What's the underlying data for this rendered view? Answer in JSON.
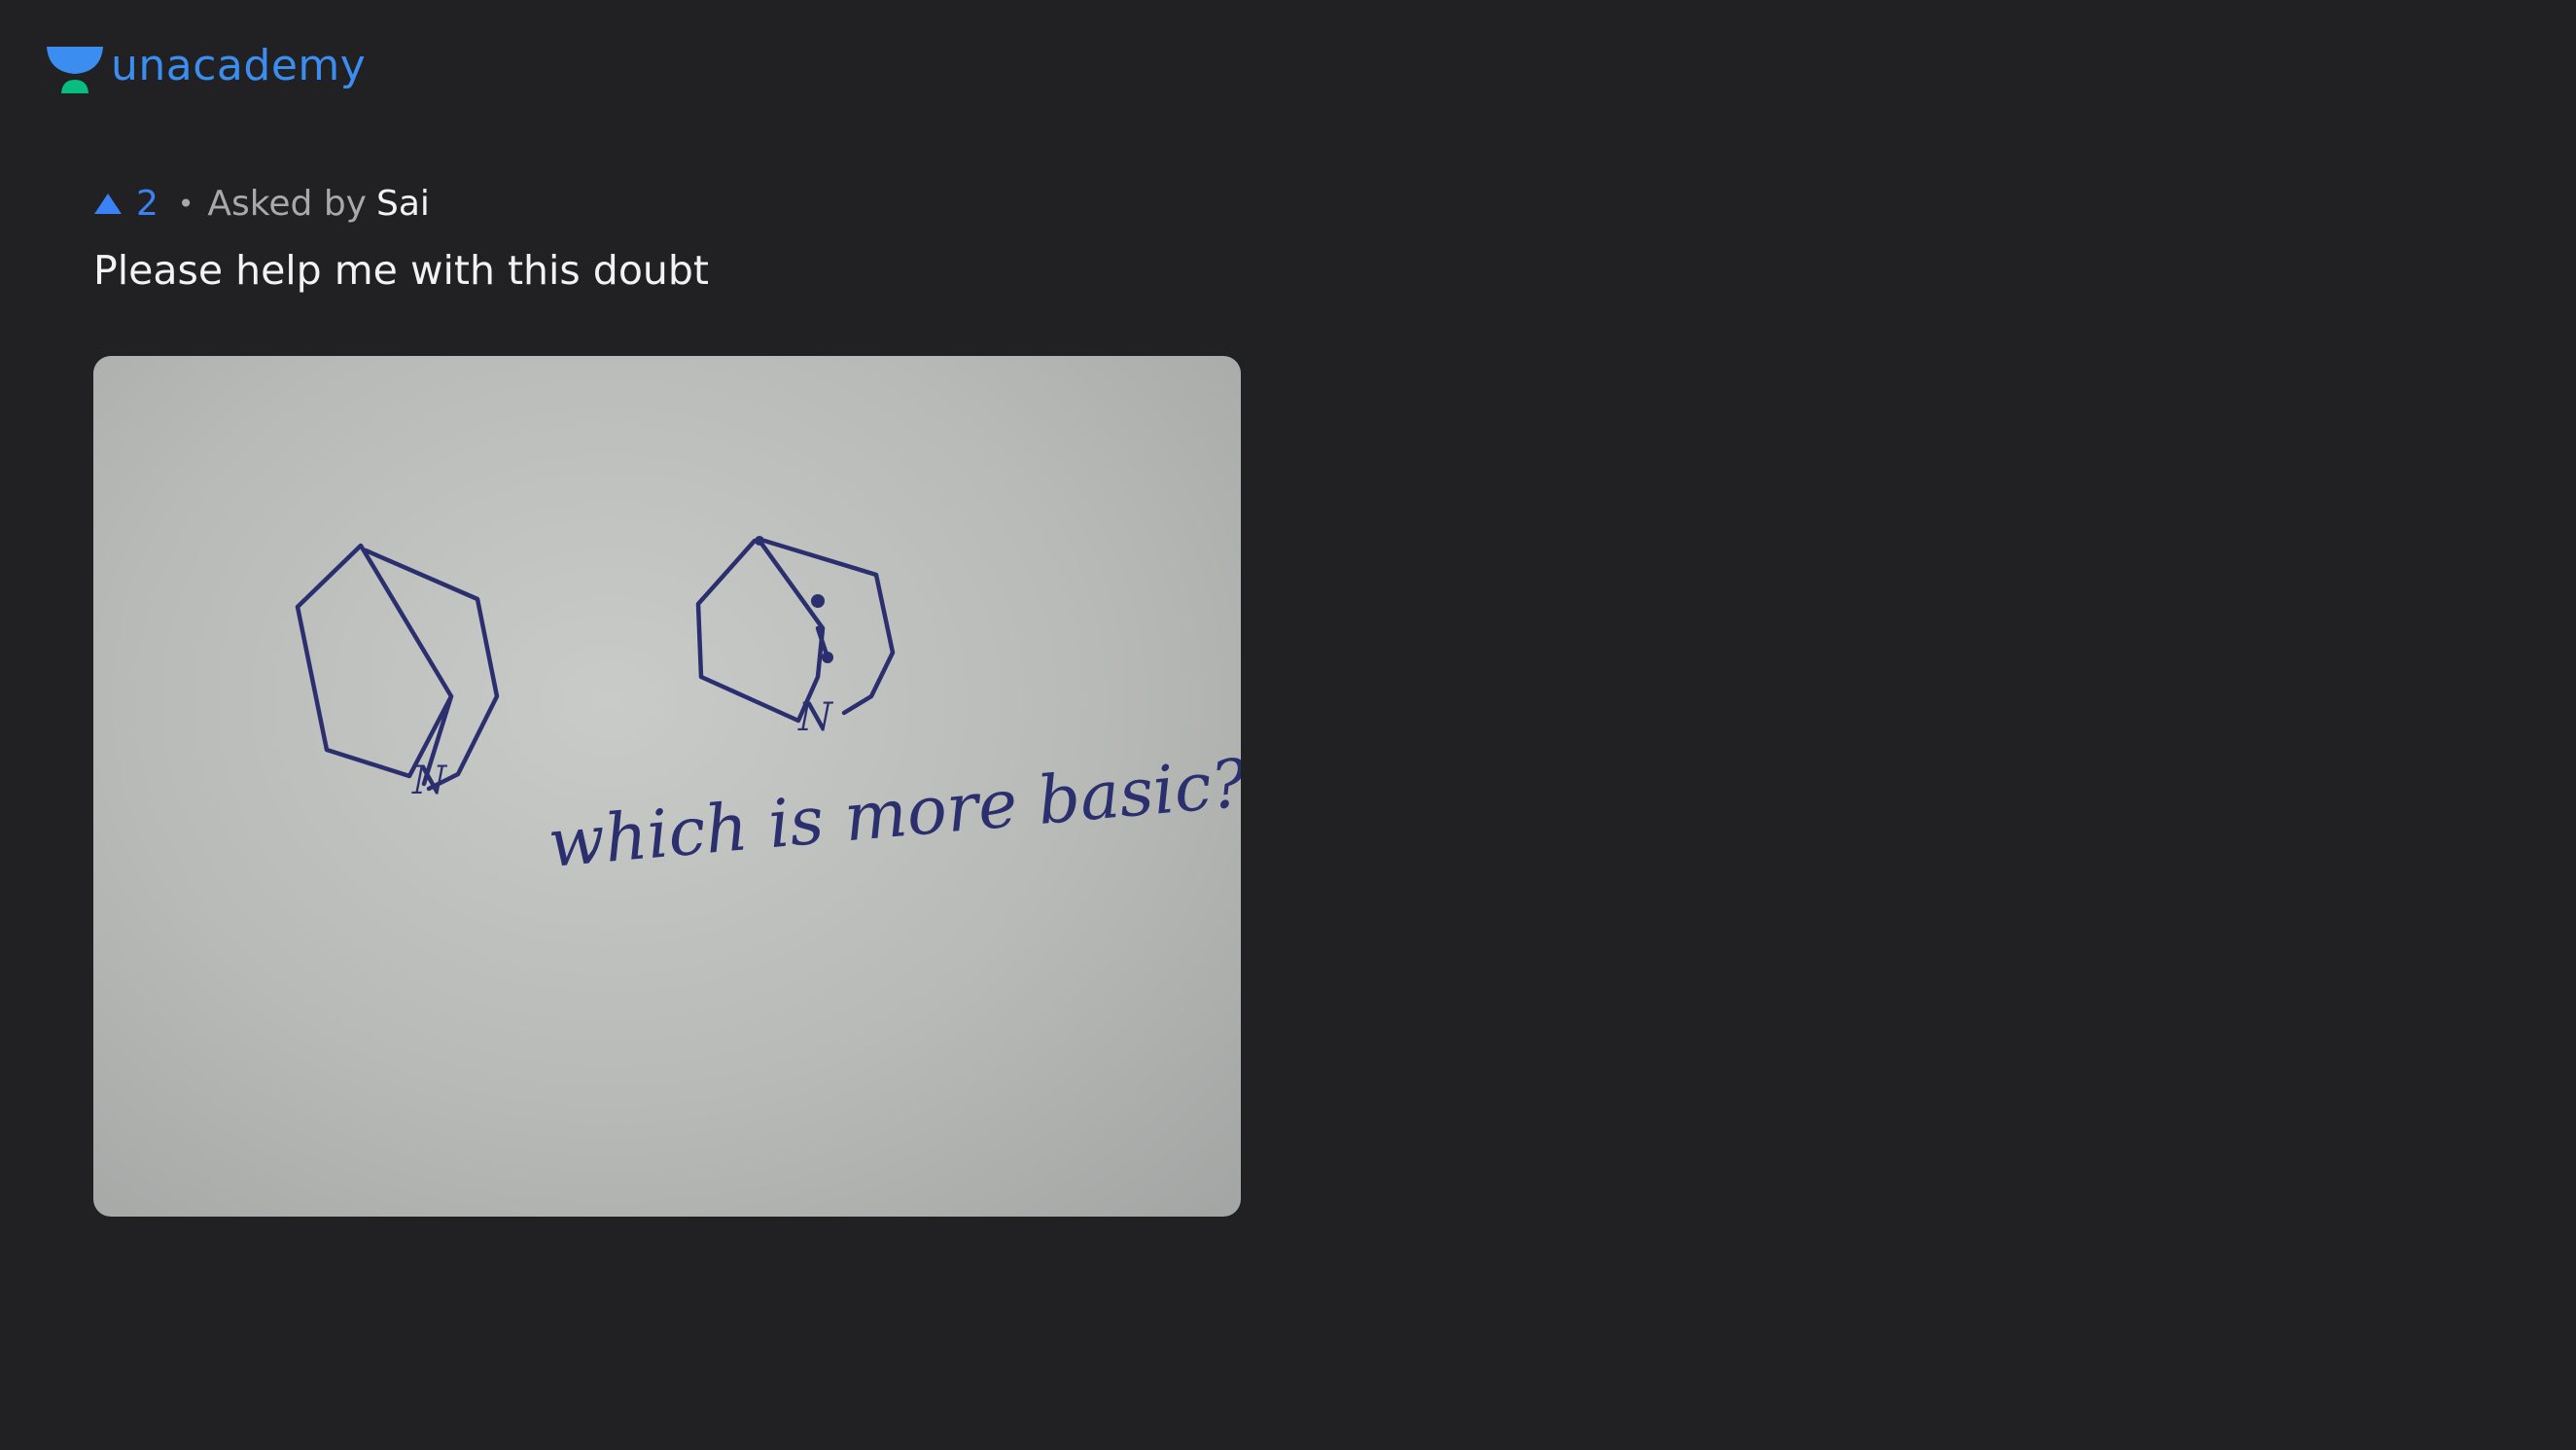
{
  "header": {
    "brand_name": "unacademy",
    "logo_icon": "unacademy-logo-icon"
  },
  "question": {
    "upvote_icon": "upvote-arrow-icon",
    "upvotes": "2",
    "separator": "•",
    "asked_by_label": "Asked by",
    "author": "Sai",
    "title": "Please help me with this doubt",
    "image_handwriting": "which is more basic?",
    "image_label_n1": "N",
    "image_label_n2": "N"
  },
  "colors": {
    "background": "#212124",
    "brand_blue": "#3c8df0",
    "brand_green": "#08bd80",
    "upvote_blue": "#3b82f6",
    "text_primary": "#f2f2f2",
    "text_secondary": "#a8a8ad",
    "ink": "#2b2f6e"
  }
}
